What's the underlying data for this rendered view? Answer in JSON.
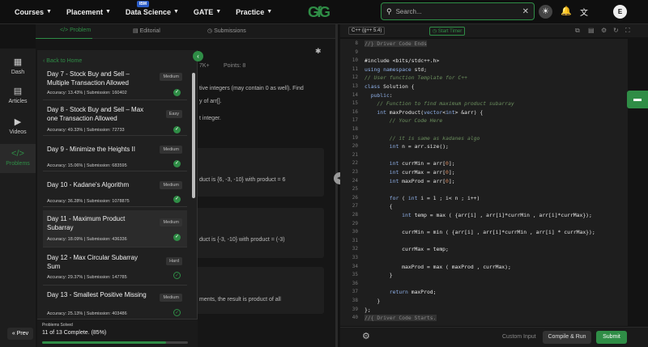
{
  "nav": {
    "items": [
      {
        "label": "Courses"
      },
      {
        "label": "Placement"
      },
      {
        "label": "Data Science",
        "badge": "IBM"
      },
      {
        "label": "GATE"
      },
      {
        "label": "Practice"
      }
    ],
    "logo": "GfG",
    "search_placeholder": "Search...",
    "avatar_letter": "E"
  },
  "rail": {
    "items": [
      {
        "label": "Dash",
        "icon": "dashboard-icon"
      },
      {
        "label": "Articles",
        "icon": "article-icon"
      },
      {
        "label": "Videos",
        "icon": "video-icon"
      },
      {
        "label": "Problems",
        "icon": "code-icon",
        "active": true
      }
    ],
    "prev_label": "Prev"
  },
  "problem_tabs": {
    "problem": "Problem",
    "editorial": "Editorial",
    "submissions": "Submissions"
  },
  "problem_bg": {
    "meta_tail": "7K+",
    "points": "Points: 8",
    "desc1": "tive integers (may contain 0 as well). Find",
    "desc2": "y of arr[].",
    "desc3": "t integer.",
    "ex1": "duct is {6, -3, -10} with product = 6",
    "ex2": "duct is {-3, -10} with product = (-3)",
    "ex3": "ments, the result is product of all"
  },
  "overlay": {
    "back_label": "Back to Home",
    "cards": [
      {
        "title": "Day 7 - Stock Buy and Sell – Multiple Transaction Allowed",
        "stats": "Accuracy: 13.43% | Submission: 160402",
        "difficulty": "Medium",
        "status": "solved"
      },
      {
        "title": "Day 8 - Stock Buy and Sell – Max one Transaction Allowed",
        "stats": "Accuracy: 49.33% | Submission: 72733",
        "difficulty": "Easy",
        "status": "solved"
      },
      {
        "title": "Day 9 - Minimize the Heights II",
        "stats": "Accuracy: 15.06% | Submission: 683595",
        "difficulty": "Medium",
        "status": "solved"
      },
      {
        "title": "Day 10 - Kadane's Algorithm",
        "stats": "Accuracy: 36.28% | Submission: 1078875",
        "difficulty": "Medium",
        "status": "solved"
      },
      {
        "title": "Day 11 - Maximum Product Subarray",
        "stats": "Accuracy: 18.09% | Submission: 436336",
        "difficulty": "Medium",
        "status": "solved",
        "active": true
      },
      {
        "title": "Day 12 - Max Circular Subarray Sum",
        "stats": "Accuracy: 29.37% | Submission: 147785",
        "difficulty": "Hard",
        "status": "attempted"
      },
      {
        "title": "Day 13 - Smallest Positive Missing",
        "stats": "Accuracy: 25.13% | Submission: 403486",
        "difficulty": "Medium",
        "status": "attempted"
      }
    ],
    "solved_label": "Problems Solved",
    "solved_count": "11 of 13 Complete. (85%)",
    "solved_fraction": 0.85
  },
  "editor": {
    "language": "C++ (g++ 5.4)",
    "timer_label": "Start Timer",
    "custom_input": "Custom Input",
    "compile_run": "Compile & Run",
    "submit": "Submit",
    "line_numbers": [
      "8",
      "9",
      "10",
      "11",
      "12",
      "13",
      "14",
      "15",
      "16",
      "17",
      "18",
      "19",
      "20",
      "21",
      "22",
      "23",
      "24",
      "25",
      "26",
      "27",
      "28",
      "29",
      "30",
      "31",
      "32",
      "33",
      "34",
      "35",
      "36",
      "37",
      "38",
      "39",
      "40"
    ],
    "lines": [
      "//} Driver Code Ends",
      "",
      "#include <bits/stdc++.h>",
      "using namespace std;",
      "// User function Template for C++",
      "class Solution {",
      "  public:",
      "    // Function to find maximum product subarray",
      "    int maxProduct(vector<int> &arr) {",
      "        // Your Code Here",
      "",
      "        // it is same as kadanes algo",
      "        int n = arr.size();",
      "",
      "        int currMin = arr[0];",
      "        int currMax = arr[0];",
      "        int maxProd = arr[0];",
      "",
      "        for ( int i = 1 ; i< n ; i++)",
      "        {",
      "            int temp = max ( {arr[i] , arr[i]*currMin , arr[i]*currMax});",
      "",
      "            currMin = min ( {arr[i] , arr[i]*currMin , arr[i] * currMax});",
      "",
      "            currMax = temp;",
      "",
      "            maxProd = max ( maxProd , currMax);",
      "        }",
      "",
      "        return maxProd;",
      "    }",
      "};",
      "//{ Driver Code Starts."
    ]
  }
}
